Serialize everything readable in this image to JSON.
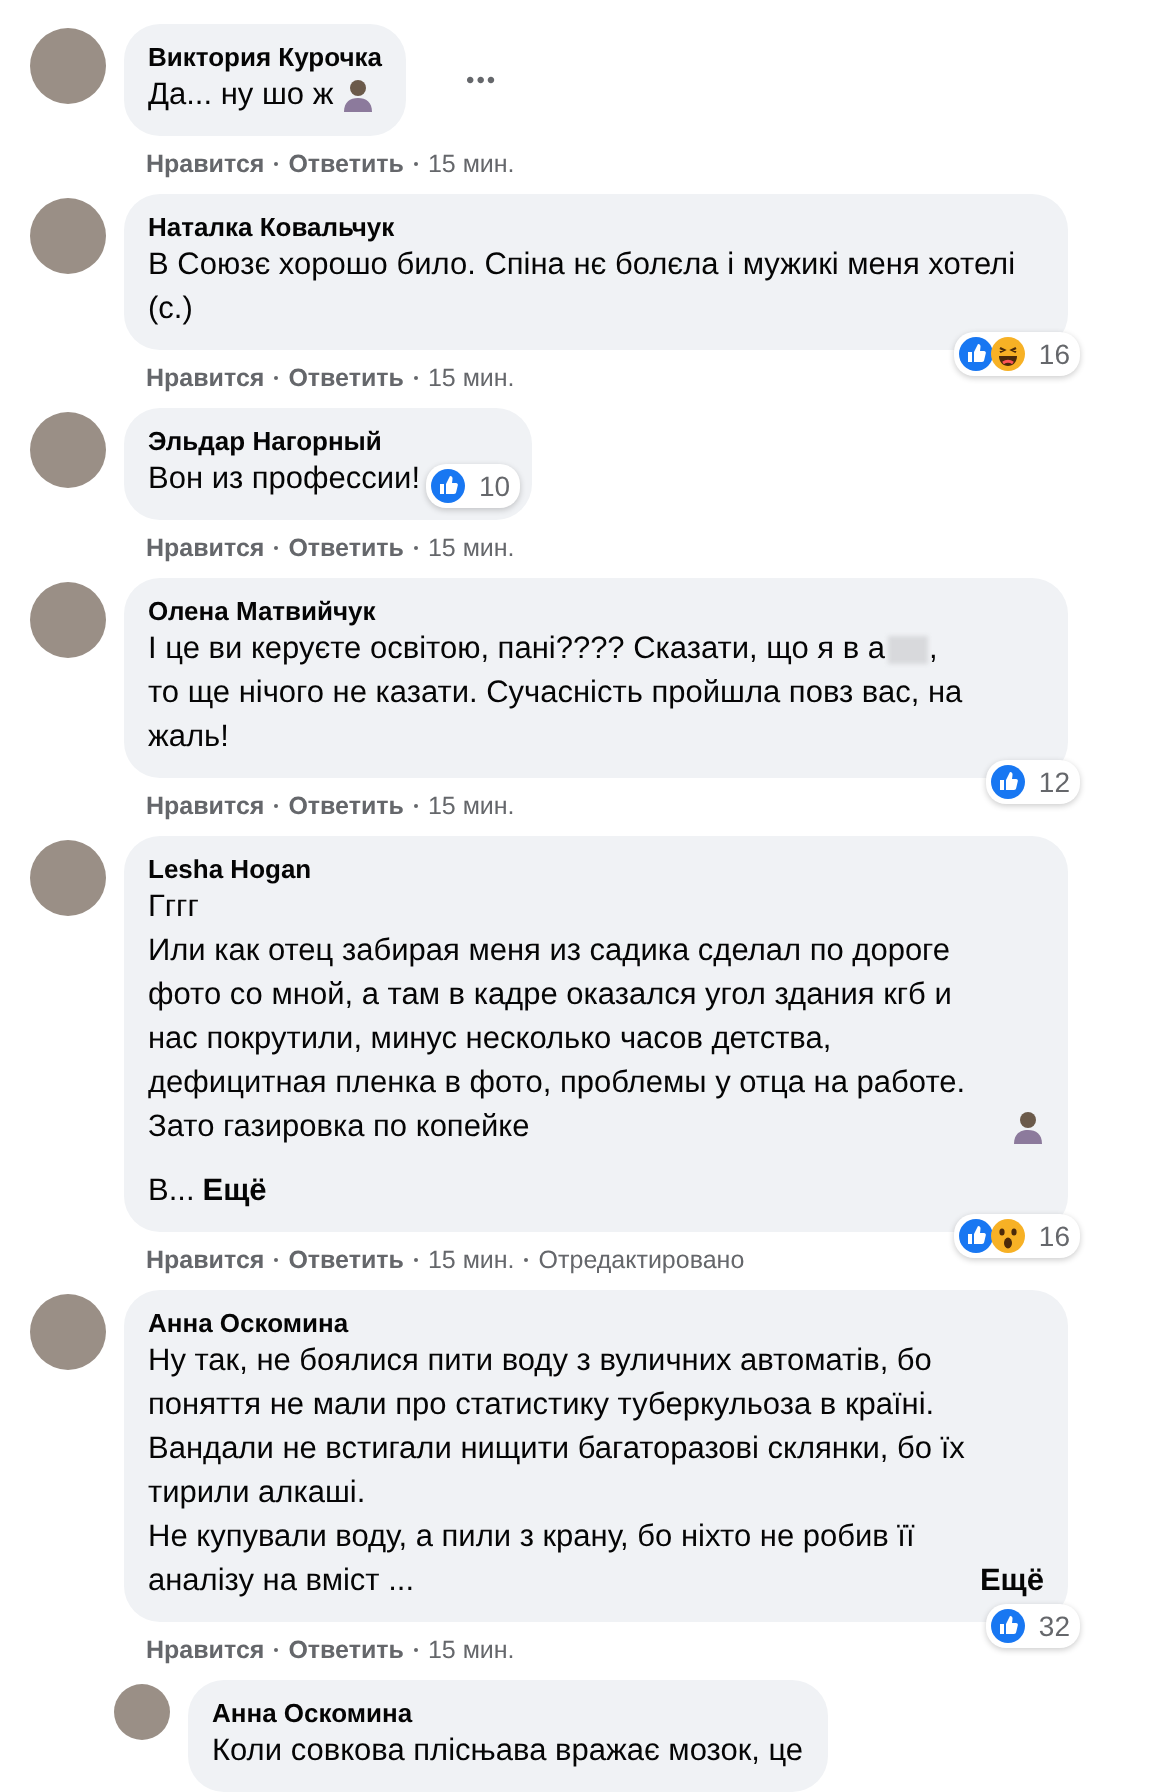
{
  "comments": [
    {
      "author": "Виктория Курочка",
      "body": [
        {
          "text": "Да... ну шо ж",
          "emoji": true
        }
      ],
      "menu": "•••",
      "like": "Нравится",
      "reply": "Ответить",
      "time": "15 мин."
    },
    {
      "author": "Наталка Ковальчук",
      "body": [
        {
          "text": "В Союзє хорошо било. Спіна нє болєла і мужикі меня хотелі (с.)"
        }
      ],
      "reactions": [
        {
          "kind": "like"
        },
        {
          "kind": "haha"
        }
      ],
      "count": "16",
      "like": "Нравится",
      "reply": "Ответить",
      "time": "15 мин."
    },
    {
      "author": "Эльдар Нагорный",
      "body": [
        {
          "text": "Вон из профессии!"
        }
      ],
      "reactions": [
        {
          "kind": "like"
        }
      ],
      "count": "10",
      "like": "Нравится",
      "reply": "Ответить",
      "time": "15 мин.",
      "inline_reactions": true
    },
    {
      "author": "Олена Матвийчук",
      "body": [
        {
          "text": "І це ви керуєте освітою, пані???? Сказати, що я в а",
          "after_blur": ","
        },
        {
          "text": "то ще нічого не казати. Сучасність пройшла повз вас, на жаль!"
        }
      ],
      "reactions": [
        {
          "kind": "like"
        }
      ],
      "count": "12",
      "like": "Нравится",
      "reply": "Ответить",
      "time": "15 мин."
    },
    {
      "author": "Lesha Hogan",
      "body": [
        {
          "text": "Гггг"
        },
        {
          "text": "Или как отец забирая меня из садика сделал по дороге фото со мной, а там в кадре оказался угол здания кгб и нас покрутили, минус несколько часов детства, дефицитная пленка в фото, проблемы у отца на работе. Зато газировка по копейке",
          "emoji": true
        },
        {
          "text": "В...",
          "more": "Ещё",
          "spaced": true
        }
      ],
      "reactions": [
        {
          "kind": "like"
        },
        {
          "kind": "wow"
        }
      ],
      "count": "16",
      "like": "Нравится",
      "reply": "Ответить",
      "time": "15 мин.",
      "edited": "Отредактировано"
    },
    {
      "author": "Анна Оскомина",
      "body": [
        {
          "text": "Ну так, не боялися пити воду з вуличних автоматів, бо поняття не мали про статистику туберкульоза в країні. Вандали не встигали нищити багаторазові склянки, бо їх тирили алкаші."
        },
        {
          "text": "Не купували воду, а пили з крану, бо ніхто не робив її аналізу на вміст ...",
          "more": "Ещё"
        }
      ],
      "reactions": [
        {
          "kind": "like"
        }
      ],
      "count": "32",
      "like": "Нравится",
      "reply": "Ответить",
      "time": "15 мин.",
      "replies": [
        {
          "author": "Анна Оскомина",
          "body": [
            {
              "text": "Коли совкова плісњава вражає мозок, це"
            }
          ]
        }
      ]
    }
  ]
}
